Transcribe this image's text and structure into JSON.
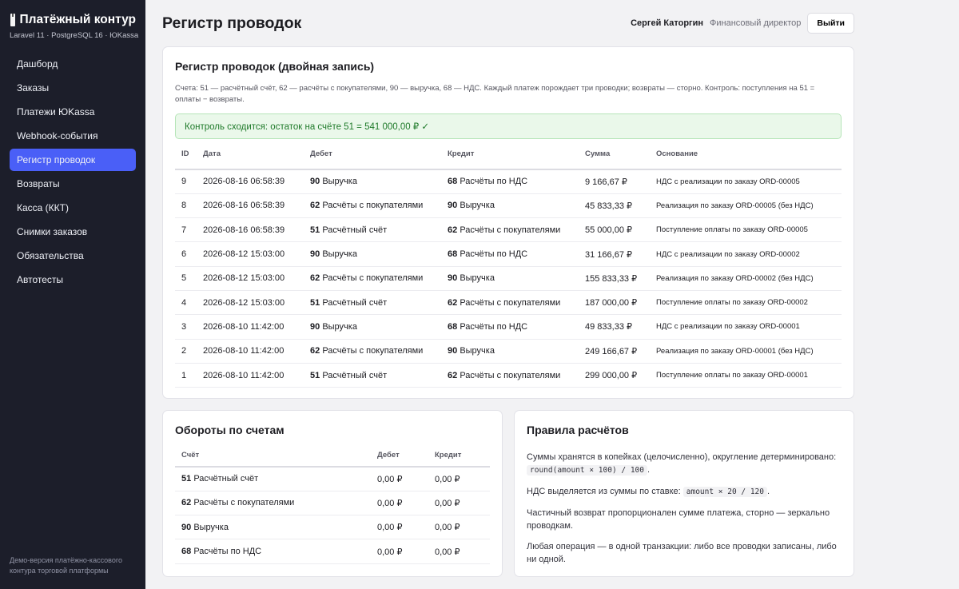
{
  "brand": {
    "title": "Платёжный контур",
    "subtitle": "Laravel 11 · PostgreSQL 16 · ЮKassa",
    "icon": "document-icon"
  },
  "nav": [
    {
      "label": "Дашборд"
    },
    {
      "label": "Заказы"
    },
    {
      "label": "Платежи ЮKassa"
    },
    {
      "label": "Webhook-события"
    },
    {
      "label": "Регистр проводок",
      "active": true
    },
    {
      "label": "Возвраты"
    },
    {
      "label": "Касса (ККТ)"
    },
    {
      "label": "Снимки заказов"
    },
    {
      "label": "Обязательства"
    },
    {
      "label": "Автотесты"
    }
  ],
  "sidebar_footer": "Демо-версия платёжно-кассового контура торговой платформы",
  "header": {
    "title": "Регистр проводок",
    "user_name": "Сергей Каторгин",
    "user_role": "Финансовый директор",
    "logout": "Выйти"
  },
  "ledger": {
    "title": "Регистр проводок (двойная запись)",
    "description": "Счета: 51 — расчётный счёт, 62 — расчёты с покупателями, 90 — выручка, 68 — НДС. Каждый платеж порождает три проводки; возвраты — сторно. Контроль: поступления на 51 = оплаты − возвраты.",
    "alert": "Контроль сходится: остаток на счёте 51 = 541 000,00 ₽ ✓",
    "columns": [
      "ID",
      "Дата",
      "Дебет",
      "Кредит",
      "Сумма",
      "Основание"
    ],
    "rows": [
      {
        "id": "9",
        "date": "2026-08-16 06:58:39",
        "debit_code": "90",
        "debit_name": "Выручка",
        "credit_code": "68",
        "credit_name": "Расчёты по НДС",
        "amount": "9 166,67 ₽",
        "reason": "НДС с реализации по заказу ORD-00005"
      },
      {
        "id": "8",
        "date": "2026-08-16 06:58:39",
        "debit_code": "62",
        "debit_name": "Расчёты с покупателями",
        "credit_code": "90",
        "credit_name": "Выручка",
        "amount": "45 833,33 ₽",
        "reason": "Реализация по заказу ORD-00005 (без НДС)"
      },
      {
        "id": "7",
        "date": "2026-08-16 06:58:39",
        "debit_code": "51",
        "debit_name": "Расчётный счёт",
        "credit_code": "62",
        "credit_name": "Расчёты с покупателями",
        "amount": "55 000,00 ₽",
        "reason": "Поступление оплаты по заказу ORD-00005"
      },
      {
        "id": "6",
        "date": "2026-08-12 15:03:00",
        "debit_code": "90",
        "debit_name": "Выручка",
        "credit_code": "68",
        "credit_name": "Расчёты по НДС",
        "amount": "31 166,67 ₽",
        "reason": "НДС с реализации по заказу ORD-00002"
      },
      {
        "id": "5",
        "date": "2026-08-12 15:03:00",
        "debit_code": "62",
        "debit_name": "Расчёты с покупателями",
        "credit_code": "90",
        "credit_name": "Выручка",
        "amount": "155 833,33 ₽",
        "reason": "Реализация по заказу ORD-00002 (без НДС)"
      },
      {
        "id": "4",
        "date": "2026-08-12 15:03:00",
        "debit_code": "51",
        "debit_name": "Расчётный счёт",
        "credit_code": "62",
        "credit_name": "Расчёты с покупателями",
        "amount": "187 000,00 ₽",
        "reason": "Поступление оплаты по заказу ORD-00002"
      },
      {
        "id": "3",
        "date": "2026-08-10 11:42:00",
        "debit_code": "90",
        "debit_name": "Выручка",
        "credit_code": "68",
        "credit_name": "Расчёты по НДС",
        "amount": "49 833,33 ₽",
        "reason": "НДС с реализации по заказу ORD-00001"
      },
      {
        "id": "2",
        "date": "2026-08-10 11:42:00",
        "debit_code": "62",
        "debit_name": "Расчёты с покупателями",
        "credit_code": "90",
        "credit_name": "Выручка",
        "amount": "249 166,67 ₽",
        "reason": "Реализация по заказу ORD-00001 (без НДС)"
      },
      {
        "id": "1",
        "date": "2026-08-10 11:42:00",
        "debit_code": "51",
        "debit_name": "Расчётный счёт",
        "credit_code": "62",
        "credit_name": "Расчёты с покупателями",
        "amount": "299 000,00 ₽",
        "reason": "Поступление оплаты по заказу ORD-00001"
      }
    ]
  },
  "turnover": {
    "title": "Обороты по счетам",
    "columns": [
      "Счёт",
      "Дебет",
      "Кредит"
    ],
    "rows": [
      {
        "code": "51",
        "name": "Расчётный счёт",
        "debit": "0,00 ₽",
        "credit": "0,00 ₽"
      },
      {
        "code": "62",
        "name": "Расчёты с покупателями",
        "debit": "0,00 ₽",
        "credit": "0,00 ₽"
      },
      {
        "code": "90",
        "name": "Выручка",
        "debit": "0,00 ₽",
        "credit": "0,00 ₽"
      },
      {
        "code": "68",
        "name": "Расчёты по НДС",
        "debit": "0,00 ₽",
        "credit": "0,00 ₽"
      }
    ]
  },
  "rules": {
    "title": "Правила расчётов",
    "r1_text": "Суммы хранятся в копейках (целочисленно), округление детерминировано:",
    "r1_code": "round(amount × 100) / 100",
    "r1_end": ".",
    "r2_text": "НДС выделяется из суммы по ставке:",
    "r2_code": "amount × 20 / 120",
    "r2_end": ".",
    "r3_text": "Частичный возврат пропорционален сумме платежа, сторно — зеркально проводкам.",
    "r4_text": "Любая операция — в одной транзакции: либо все проводки записаны, либо ни одной."
  }
}
